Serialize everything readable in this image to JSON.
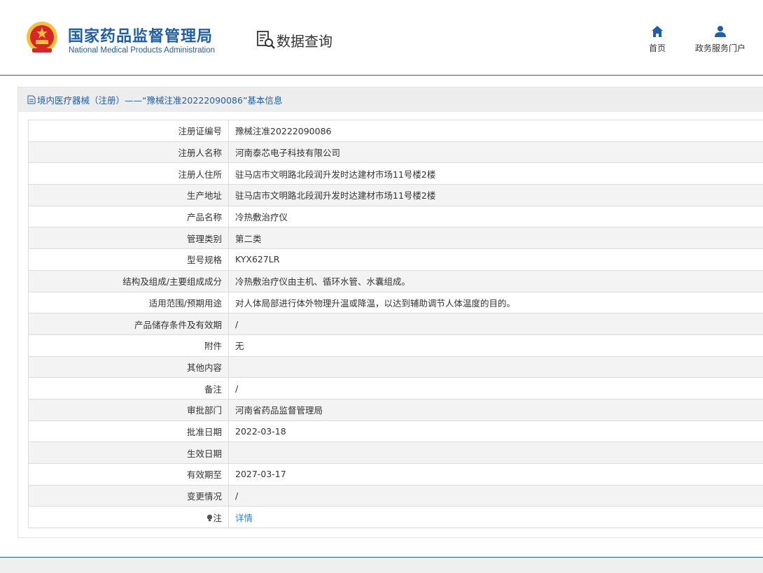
{
  "header": {
    "org_name_cn": "国家药品监督管理局",
    "org_name_en": "National Medical Products Administration",
    "emblem_icon": "national-emblem-icon",
    "query_icon": "search-document-icon",
    "query_title": "数据查询",
    "nav": [
      {
        "label": "首页",
        "icon": "home-icon"
      },
      {
        "label": "政务服务门户",
        "icon": "user-icon"
      }
    ]
  },
  "panel": {
    "title": "境内医疗器械（注册）——“豫械注准20222090086”基本信息",
    "title_icon": "document-icon"
  },
  "fields": [
    {
      "label": "注册证编号",
      "value": "豫械注准20222090086"
    },
    {
      "label": "注册人名称",
      "value": "河南泰芯电子科技有限公司"
    },
    {
      "label": "注册人住所",
      "value": "驻马店市文明路北段润升发时达建材市场11号楼2楼"
    },
    {
      "label": "生产地址",
      "value": "驻马店市文明路北段润升发时达建材市场11号楼2楼"
    },
    {
      "label": "产品名称",
      "value": "冷热敷治疗仪"
    },
    {
      "label": "管理类别",
      "value": "第二类"
    },
    {
      "label": "型号规格",
      "value": "KYX627LR"
    },
    {
      "label": "结构及组成/主要组成成分",
      "value": "冷热敷治疗仪由主机、循环水管、水囊组成。"
    },
    {
      "label": "适用范围/预期用途",
      "value": "对人体局部进行体外物理升温或降温，以达到辅助调节人体温度的目的。"
    },
    {
      "label": "产品储存条件及有效期",
      "value": "/"
    },
    {
      "label": "附件",
      "value": "无"
    },
    {
      "label": "其他内容",
      "value": ""
    },
    {
      "label": "备注",
      "value": "/"
    },
    {
      "label": "审批部门",
      "value": "河南省药品监督管理局"
    },
    {
      "label": "批准日期",
      "value": "2022-03-18"
    },
    {
      "label": "生效日期",
      "value": ""
    },
    {
      "label": "有效期至",
      "value": "2027-03-17"
    },
    {
      "label": "变更情况",
      "value": "/"
    }
  ],
  "note": {
    "label": "注",
    "link_text": "详情",
    "icon": "bulb-icon"
  },
  "colors": {
    "brand_blue": "#1f5ea8",
    "link_blue": "#2a7fd4",
    "emblem_red": "#d8252a",
    "emblem_gold": "#f2c23a"
  }
}
